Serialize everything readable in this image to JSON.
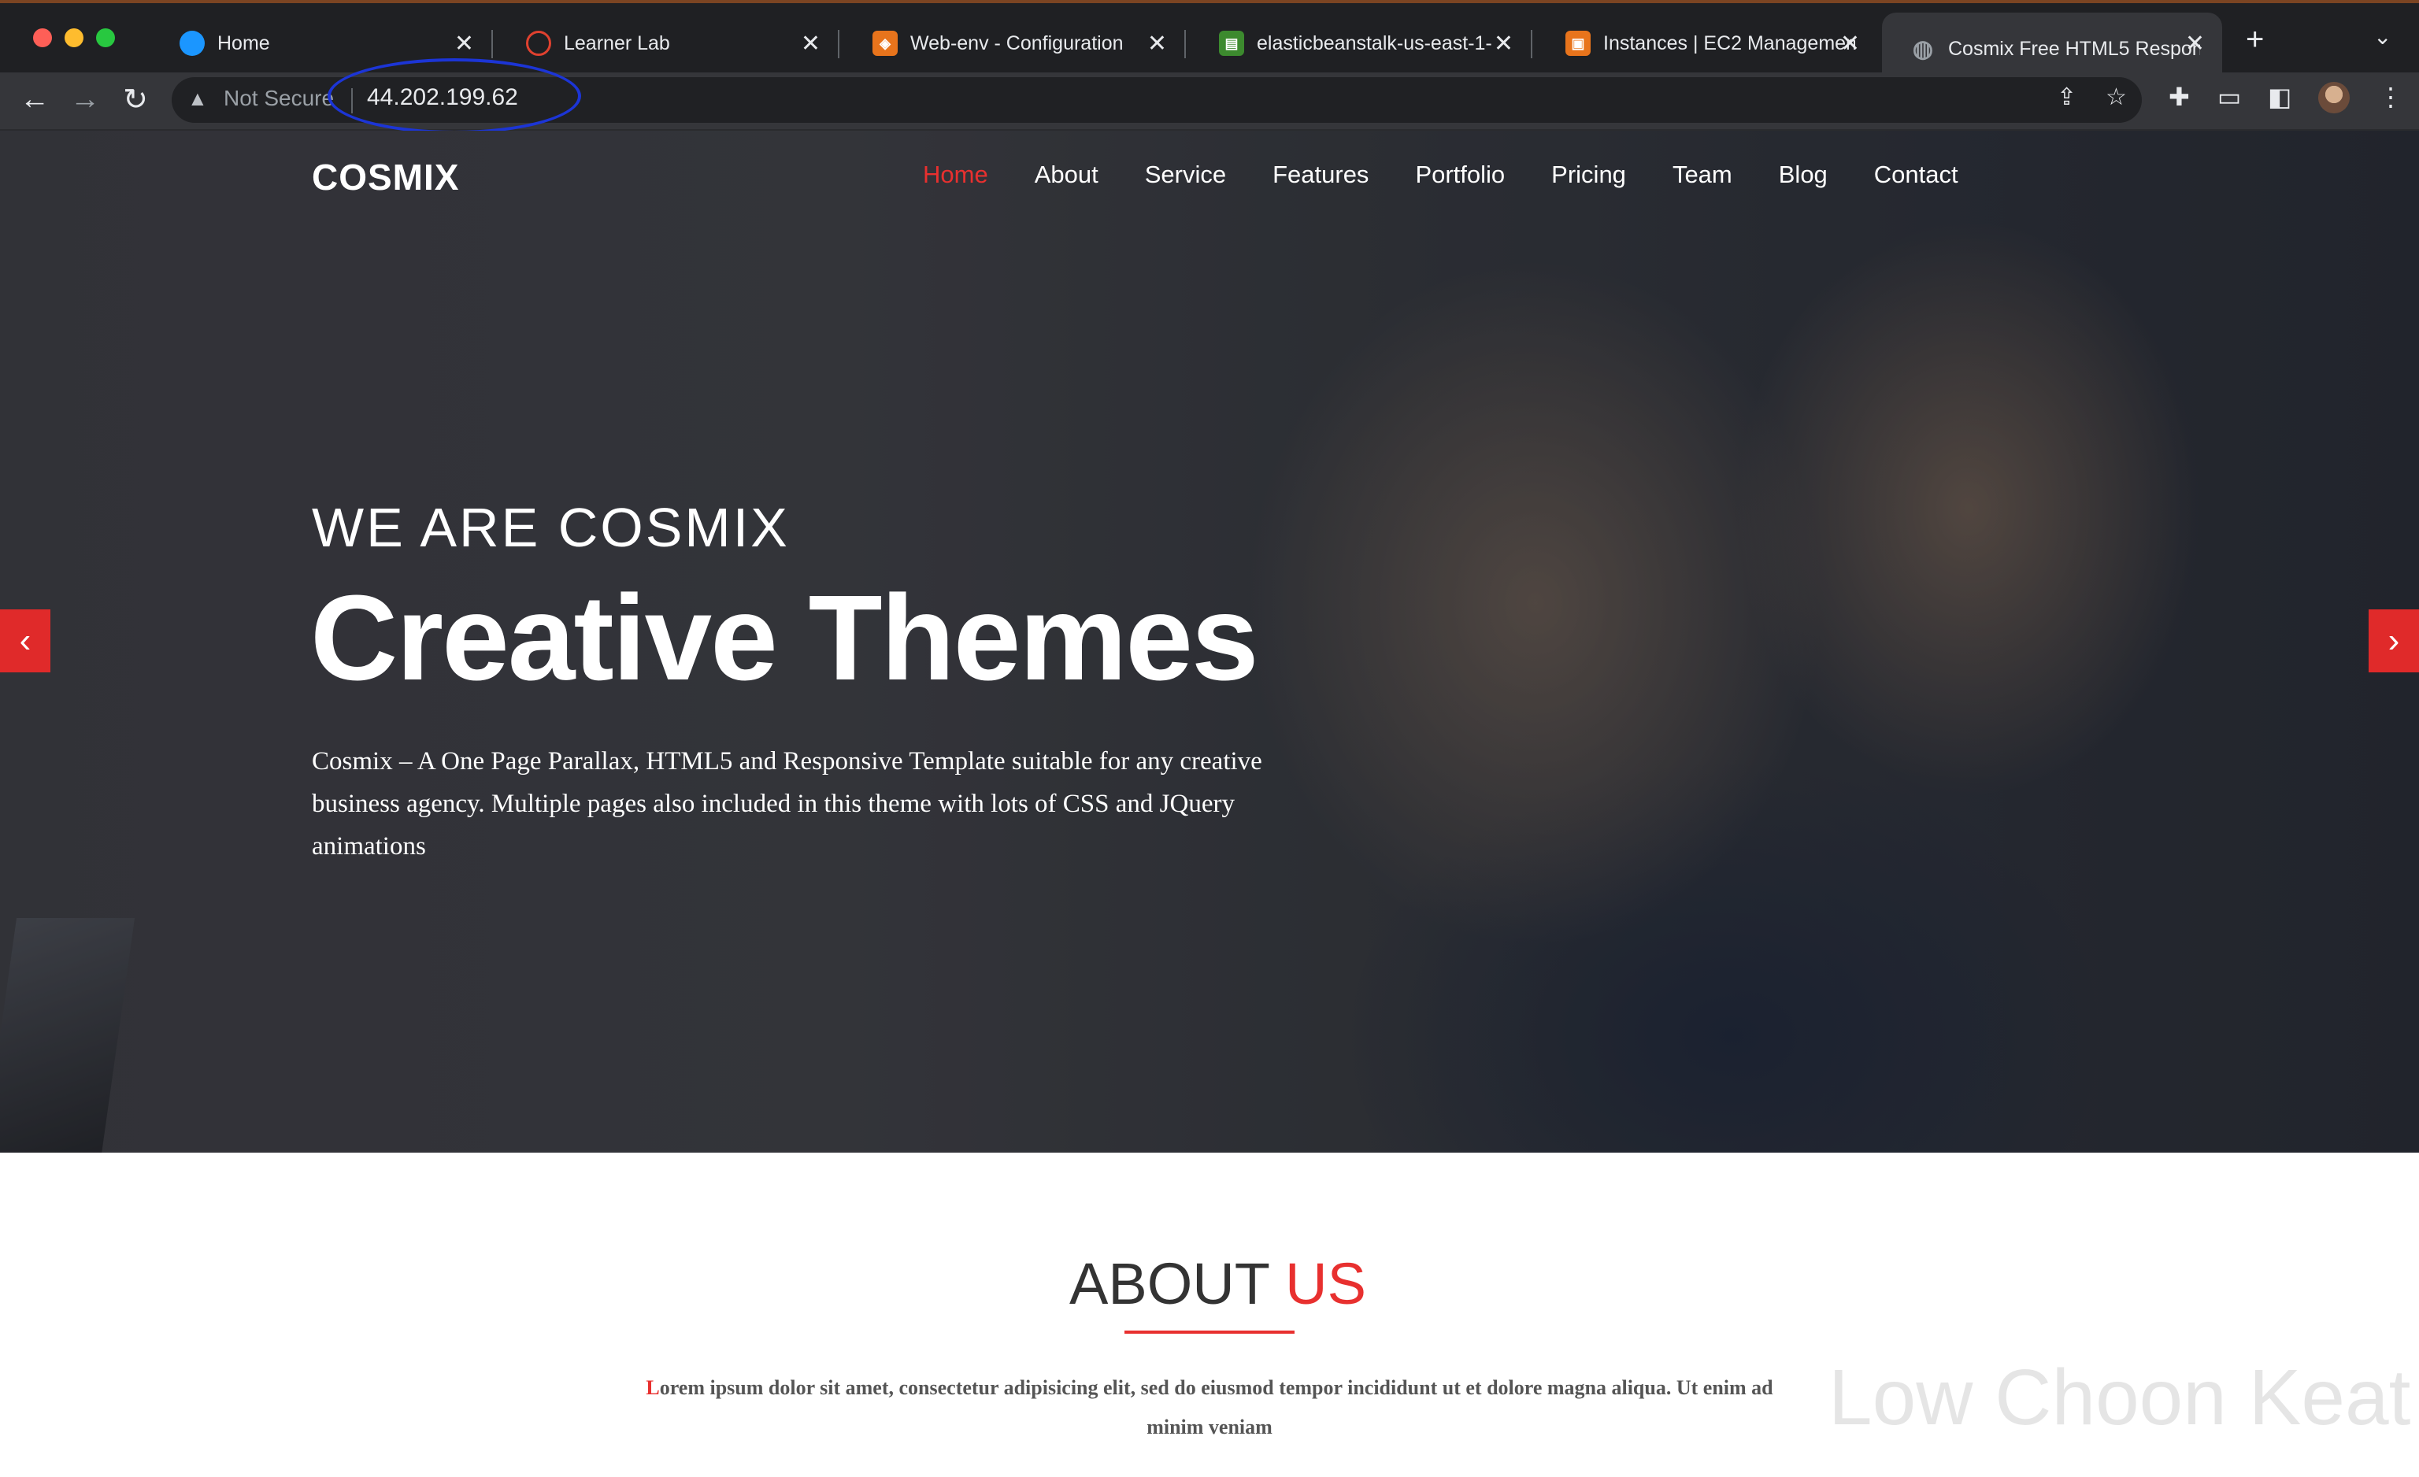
{
  "browser": {
    "tabs": [
      {
        "label": "Home",
        "favicon": "salesforce-cloud-icon",
        "favicon_color": "#1b96ff",
        "active": false
      },
      {
        "label": "Learner Lab",
        "favicon": "learner-lab-icon",
        "favicon_color": "#e0412f",
        "active": false
      },
      {
        "label": "Web-env - Configuration",
        "favicon": "aws-beanstalk-icon",
        "favicon_color": "#e8741c",
        "active": false
      },
      {
        "label": "elasticbeanstalk-us-east-1-",
        "favicon": "aws-s3-icon",
        "favicon_color": "#3c8a2e",
        "active": false
      },
      {
        "label": "Instances | EC2 Managemen",
        "favicon": "aws-ec2-icon",
        "favicon_color": "#e8741c",
        "active": false
      },
      {
        "label": "Cosmix Free HTML5 Respon",
        "favicon": "globe-icon",
        "favicon_color": "#9aa0a6",
        "active": true
      }
    ],
    "security_label": "Not Secure",
    "url": "44.202.199.62"
  },
  "site": {
    "logo": "COSMIX",
    "nav": [
      "Home",
      "About",
      "Service",
      "Features",
      "Portfolio",
      "Pricing",
      "Team",
      "Blog",
      "Contact"
    ],
    "active_nav": "Home",
    "accent_color": "#e8302f"
  },
  "hero": {
    "subtitle": "WE ARE COSMIX",
    "title": "Creative Themes",
    "description": "Cosmix – A One Page Parallax, HTML5 and Responsive Template suitable for any creative business agency. Multiple pages also included in this theme with lots of CSS and JQuery animations"
  },
  "about": {
    "title_main": "ABOUT",
    "title_accent": "US",
    "first_letter": "L",
    "text_rest": "orem ipsum dolor sit amet, consectetur adipisicing elit, sed do eiusmod tempor incididunt ut et dolore magna aliqua. Ut enim ad minim veniam"
  },
  "watermark": "Low Choon Keat"
}
